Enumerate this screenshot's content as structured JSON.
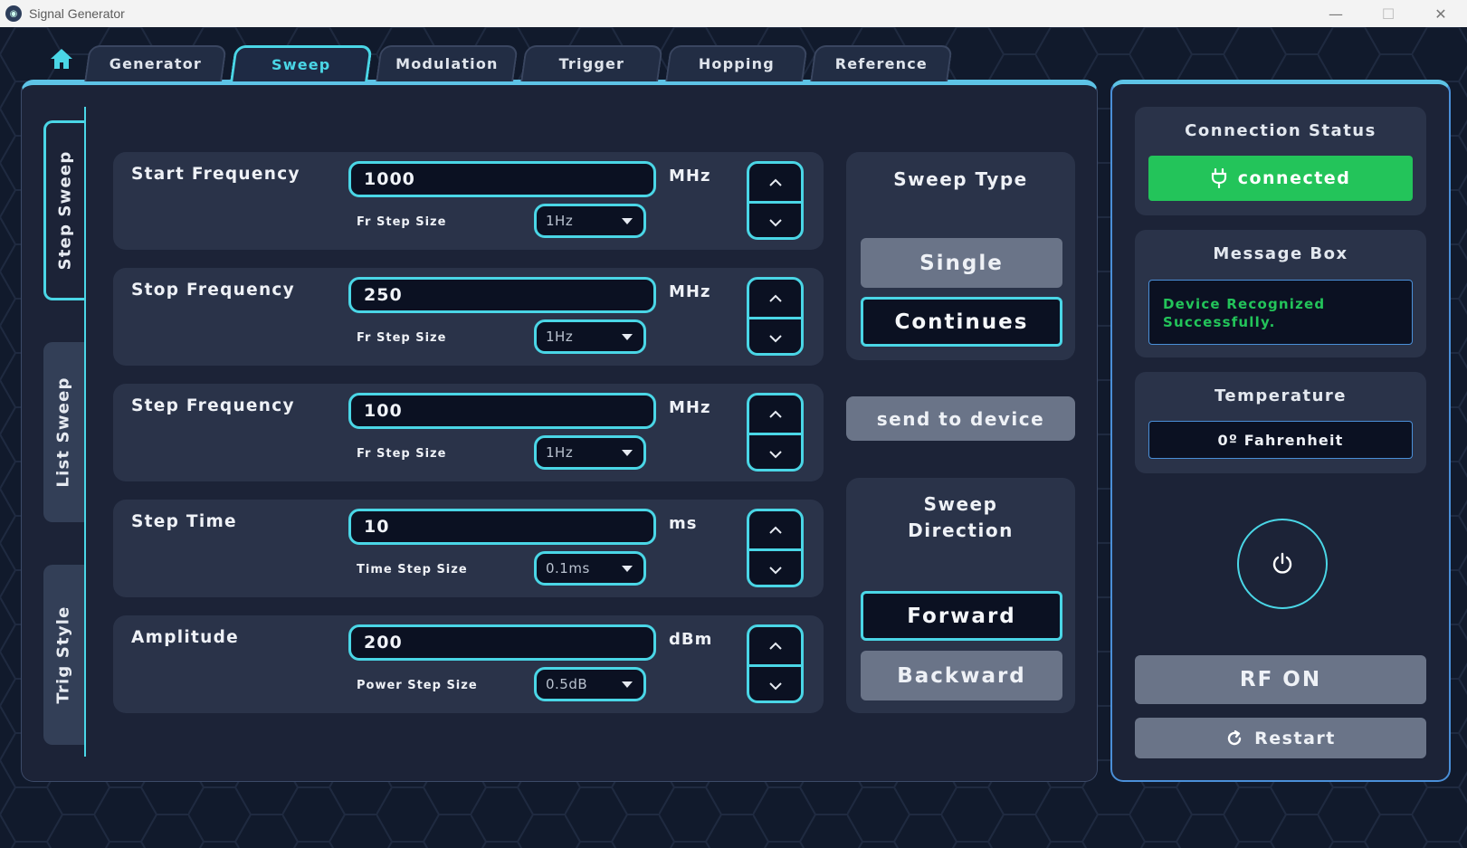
{
  "window": {
    "title": "Signal Generator",
    "minimize": "—",
    "maximize": "☐",
    "close": "✕"
  },
  "tabs": [
    {
      "label": "Generator"
    },
    {
      "label": "Sweep",
      "active": true
    },
    {
      "label": "Modulation"
    },
    {
      "label": "Trigger"
    },
    {
      "label": "Hopping"
    },
    {
      "label": "Reference"
    }
  ],
  "side_tabs": [
    {
      "label": "Step Sweep",
      "active": true
    },
    {
      "label": "List Sweep"
    },
    {
      "label": "Trig Style"
    }
  ],
  "rows": [
    {
      "label": "Start Frequency",
      "value": "1000",
      "unit": "MHz",
      "step_label": "Fr Step Size",
      "step_value": "1Hz"
    },
    {
      "label": "Stop Frequency",
      "value": "250",
      "unit": "MHz",
      "step_label": "Fr Step Size",
      "step_value": "1Hz"
    },
    {
      "label": "Step Frequency",
      "value": "100",
      "unit": "MHz",
      "step_label": "Fr Step Size",
      "step_value": "1Hz"
    },
    {
      "label": "Step Time",
      "value": "10",
      "unit": "ms",
      "step_label": "Time Step Size",
      "step_value": "0.1ms"
    },
    {
      "label": "Amplitude",
      "value": "200",
      "unit": "dBm",
      "step_label": "Power Step Size",
      "step_value": "0.5dB"
    }
  ],
  "sweep_type": {
    "title": "Sweep Type",
    "single": "Single",
    "continues": "Continues",
    "selected": "Continues"
  },
  "send_button": "send to device",
  "sweep_direction": {
    "title_line1": "Sweep",
    "title_line2": "Direction",
    "forward": "Forward",
    "backward": "Backward",
    "selected": "Forward"
  },
  "status": {
    "connection_title": "Connection Status",
    "connection_value": "connected",
    "message_title": "Message Box",
    "message_text": "Device Recognized Successfully.",
    "temperature_title": "Temperature",
    "temperature_value": "0º Fahrenheit"
  },
  "rf_button": "RF ON",
  "restart_button": "Restart",
  "colors": {
    "background": "#111a2c",
    "panel": "#1c2337",
    "card": "#2a3349",
    "accent": "#4ad6e6",
    "connected": "#23c45a",
    "button_gray": "#6a7488"
  },
  "icons": {
    "home": "home-icon",
    "plug": "plug-icon",
    "power": "power-icon",
    "restart": "restart-icon",
    "up": "chevron-up-icon",
    "down": "chevron-down-icon"
  }
}
